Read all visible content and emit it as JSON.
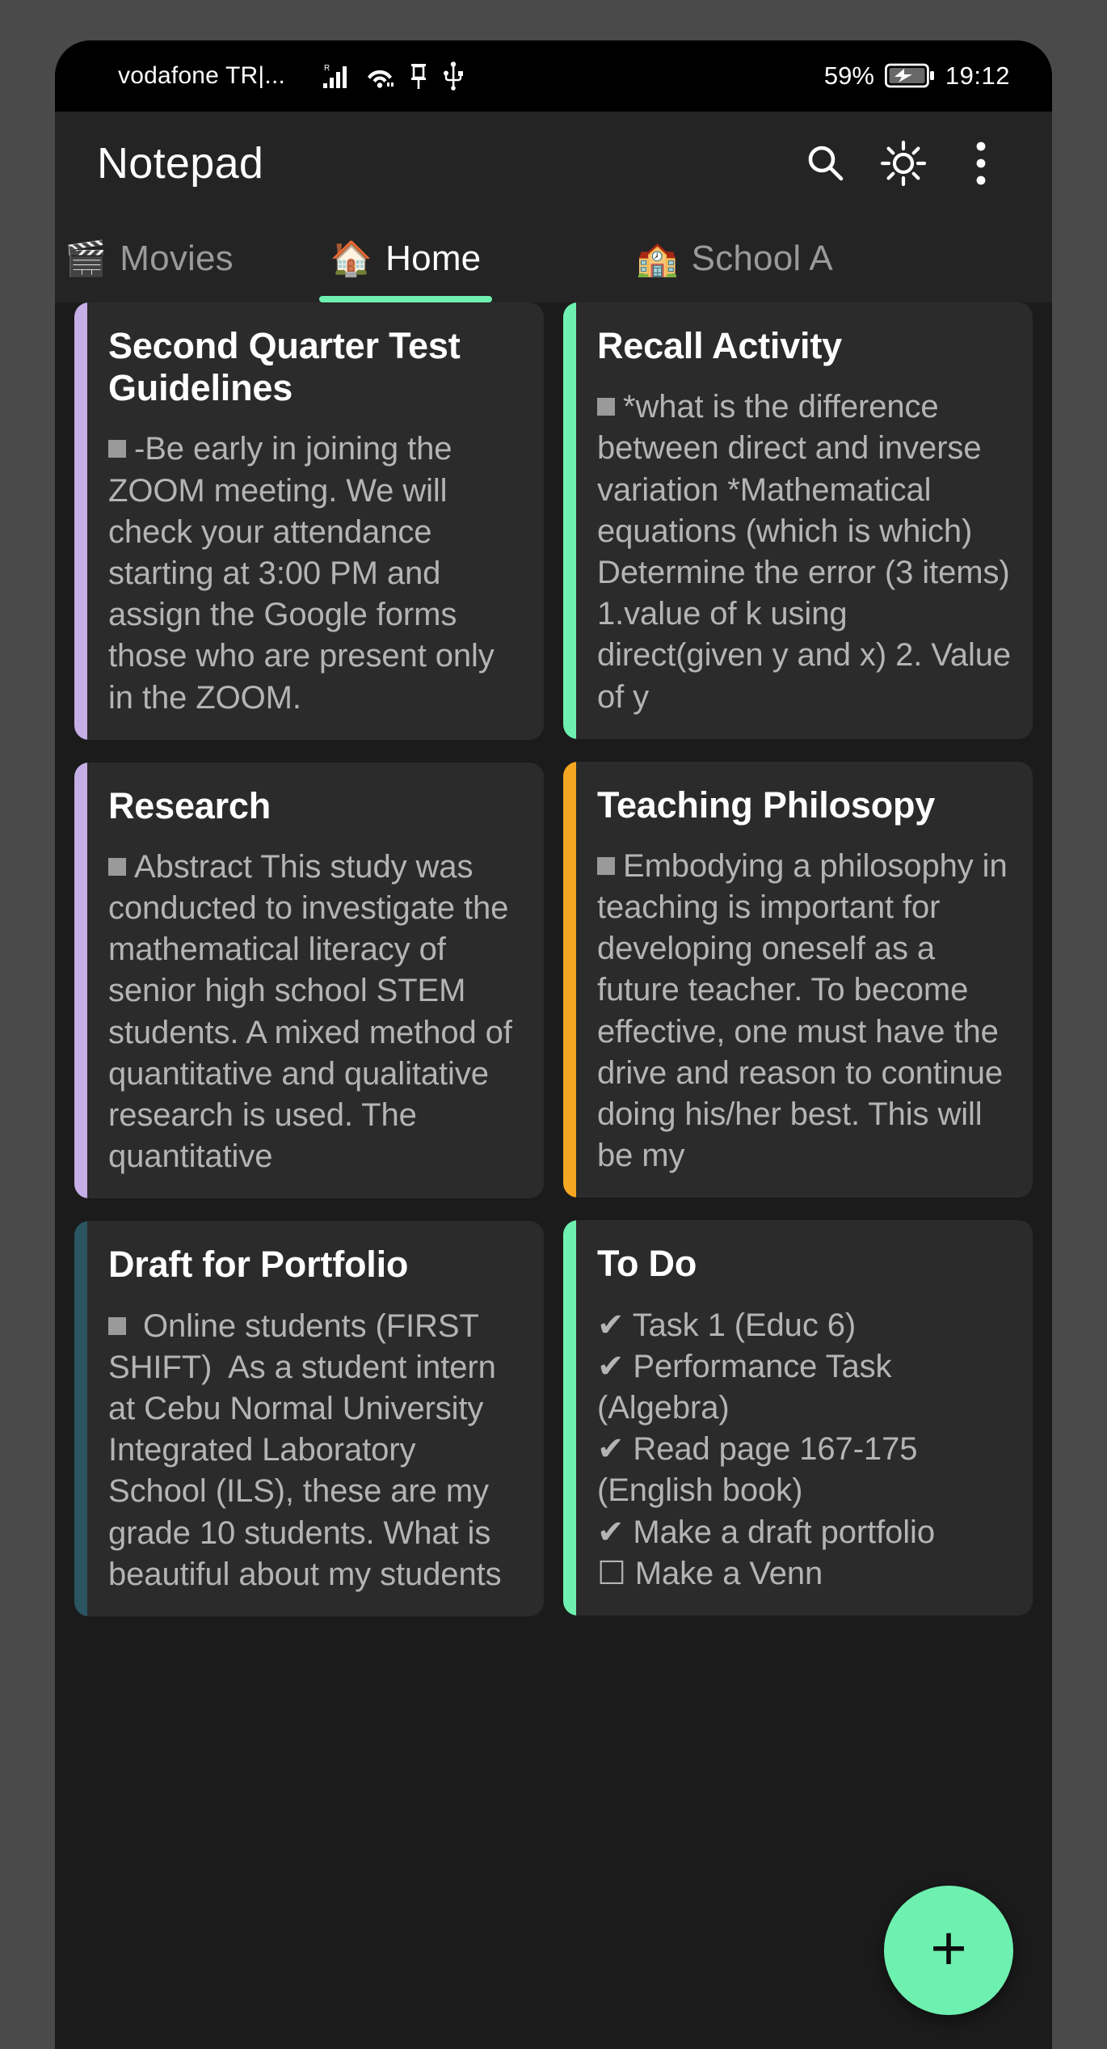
{
  "status_bar": {
    "carrier": "vodafone TR|...",
    "icons": [
      "signal-bars-roaming-icon",
      "wifi-icon",
      "pin-icon",
      "usb-icon"
    ],
    "battery_percent": "59%",
    "battery_icon": "battery-charging-icon",
    "clock": "19:12"
  },
  "app_bar": {
    "title": "Notepad",
    "actions": [
      "search-icon",
      "brightness-icon",
      "overflow-menu-icon"
    ]
  },
  "tabs": [
    {
      "emoji": "🎬",
      "label": "Movies",
      "icon_name": "movies-icon",
      "active": false
    },
    {
      "emoji": "🏠",
      "label": "Home",
      "icon_name": "home-icon",
      "active": true
    },
    {
      "emoji": "🏫",
      "label": "School A",
      "icon_name": "school-icon",
      "active": false
    }
  ],
  "colors": {
    "accent_green": "#6ef0b0",
    "accent_purple": "#c6aee6",
    "accent_orange": "#f5a623",
    "accent_teal": "#2a5561",
    "card_bg": "#2b2b2b",
    "page_bg": "#1b1b1b"
  },
  "notes": {
    "left": [
      {
        "title": "Second Quarter Test Guidelines",
        "accent": "#c6aee6",
        "body": "-Be early in joining the ZOOM meeting. We will check your attendance starting at 3:00 PM and assign the Google forms those who are present only in the ZOOM."
      },
      {
        "title": "Research",
        "accent": "#c6aee6",
        "body": "Abstract This study was conducted to investigate the mathematical literacy of senior high school STEM students. A mixed method of quantitative and qualitative research is used. The quantitative"
      },
      {
        "title": "Draft for Portfolio",
        "accent": "#2a5561",
        "body": " Online students (FIRST SHIFT)  As a student intern at Cebu Normal University Integrated Laboratory School (ILS), these are my grade 10 students. What is beautiful about my students"
      }
    ],
    "right": [
      {
        "title": "Recall Activity",
        "accent": "#6ef0b0",
        "body": "*what is the difference between direct and inverse variation *Mathematical equations (which is which) Determine the error (3 items) 1.value of k using direct(given y and x) 2. Value of y"
      },
      {
        "title": "Teaching Philosopy",
        "accent": "#f5a623",
        "body": "Embodying a philosophy in teaching is important for developing oneself as a future teacher. To become effective, one must have the drive and reason to continue doing his/her best. This will be my"
      },
      {
        "title": "To Do",
        "accent": "#6ef0b0",
        "body": "✔ Task 1 (Educ 6)\n✔ Performance Task (Algebra)\n✔ Read page 167-175 (English book)\n✔ Make a draft portfolio\n☐ Make a Venn"
      }
    ]
  },
  "fab": {
    "label": "+",
    "icon_name": "plus-icon"
  }
}
